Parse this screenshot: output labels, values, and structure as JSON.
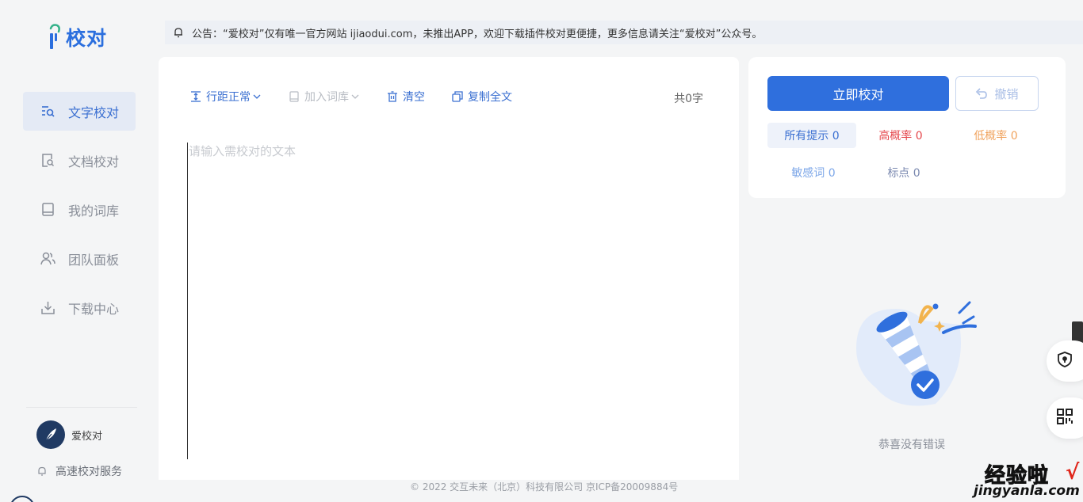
{
  "app": {
    "logo_text": "校对"
  },
  "notice": {
    "text": "公告：“爱校对”仅有唯一官方网站 ijiaodui.com，未推出APP，欢迎下载插件校对更便捷，更多信息请关注“爱校对”公众号。"
  },
  "sidebar": {
    "items": [
      {
        "label": "文字校对",
        "icon": "text-check-icon"
      },
      {
        "label": "文档校对",
        "icon": "document-search-icon"
      },
      {
        "label": "我的词库",
        "icon": "book-icon"
      },
      {
        "label": "团队面板",
        "icon": "team-icon"
      },
      {
        "label": "下载中心",
        "icon": "download-icon"
      }
    ],
    "active_index": 0,
    "user_name": "爱校对",
    "service_label": "高速校对服务"
  },
  "toolbar": {
    "line_spacing": "行距正常",
    "add_dictionary": "加入词库",
    "clear": "清空",
    "copy_all": "复制全文",
    "word_count": "共0字"
  },
  "editor": {
    "placeholder": "请输入需校对的文本"
  },
  "panel": {
    "check_button": "立即校对",
    "undo_button": "撤销",
    "stats": [
      {
        "label": "所有提示 0",
        "color": "#3a6fd1"
      },
      {
        "label": "高概率 0",
        "color": "#e5484d"
      },
      {
        "label": "低概率 0",
        "color": "#f0a35e"
      },
      {
        "label": "敏感词 0",
        "color": "#7da7e8"
      },
      {
        "label": "标点 0",
        "color": "#7b89b0"
      }
    ],
    "empty_text": "恭喜没有错误"
  },
  "footer": {
    "text": "© 2022 交互未来（北京）科技有限公司 京ICP备20009884号"
  },
  "watermark": {
    "cn": "经验啦",
    "en": "jingyanla.com",
    "check": "√"
  },
  "colors": {
    "accent": "#2f6fdd",
    "sidebar_active_bg": "#e4eaf5",
    "page_bg": "#f4f5f6"
  }
}
